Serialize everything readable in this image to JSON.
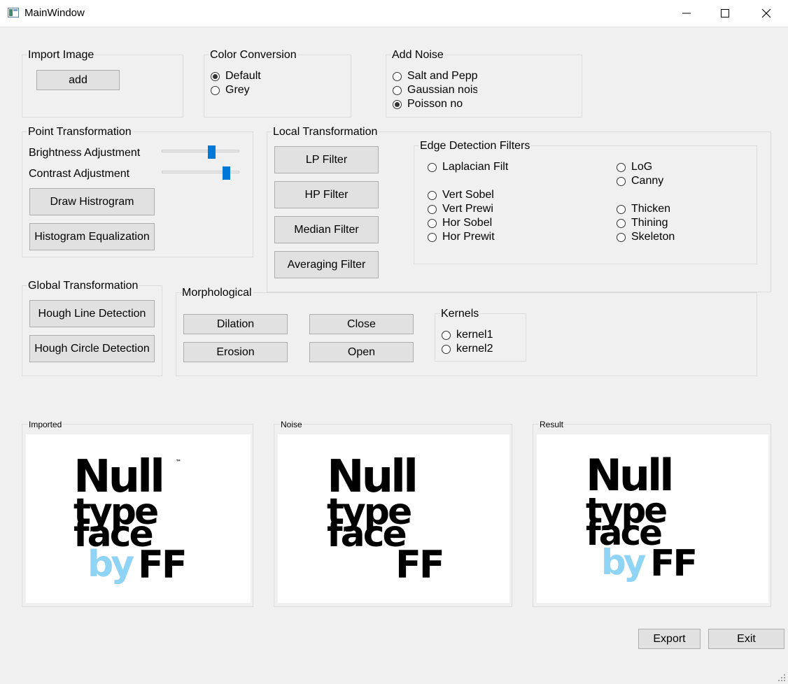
{
  "window": {
    "title": "MainWindow"
  },
  "import_image": {
    "title": "Import Image",
    "add_label": "add"
  },
  "color_conversion": {
    "title": "Color Conversion",
    "options": [
      {
        "label": "Default",
        "checked": true
      },
      {
        "label": "Grey",
        "checked": false
      }
    ]
  },
  "add_noise": {
    "title": "Add Noise",
    "options": [
      {
        "label": "Salt and Pepp",
        "checked": false
      },
      {
        "label": "Gaussian nois",
        "checked": false
      },
      {
        "label": "Poisson no",
        "checked": true
      }
    ]
  },
  "point_transformation": {
    "title": "Point Transformation",
    "brightness_label": "Brightness Adjustment",
    "contrast_label": "Contrast Adjustment",
    "brightness_value": 0.66,
    "contrast_value": 0.87,
    "draw_histogram_label": "Draw Histrogram",
    "histogram_equalization_label": "Histogram Equalization"
  },
  "local_transformation": {
    "title": "Local Transformation",
    "buttons": [
      "LP Filter",
      "HP Filter",
      "Median Filter",
      "Averaging Filter"
    ]
  },
  "edge_detection": {
    "title": "Edge Detection Filters",
    "left_options": [
      "Laplacian Filt",
      "Vert Sobel",
      "Vert Prewi",
      "Hor Sobel",
      "Hor Prewit"
    ],
    "right_options": [
      "LoG",
      "Canny",
      "Thicken",
      "Thining",
      "Skeleton"
    ]
  },
  "global_transformation": {
    "title": "Global Transformation",
    "hough_line_label": "Hough Line Detection",
    "hough_circle_label": "Hough Circle Detection"
  },
  "morphological": {
    "title": "Morphological",
    "dilation_label": "Dilation",
    "close_label": "Close",
    "erosion_label": "Erosion",
    "open_label": "Open",
    "kernels_title": "Kernels",
    "kernels": [
      "kernel1",
      "kernel2"
    ]
  },
  "panels": {
    "imported": "Imported",
    "noise": "Noise",
    "result": "Result"
  },
  "logo": {
    "line1": "Null",
    "line2": "type",
    "line3": "face",
    "by": "by",
    "ff": "FF",
    "tm": "™",
    "by_color": "#8fd3f5"
  },
  "footer": {
    "export_label": "Export",
    "exit_label": "Exit"
  },
  "colors": {
    "slider_thumb": "#0078d7",
    "background": "#f0f0f0"
  }
}
